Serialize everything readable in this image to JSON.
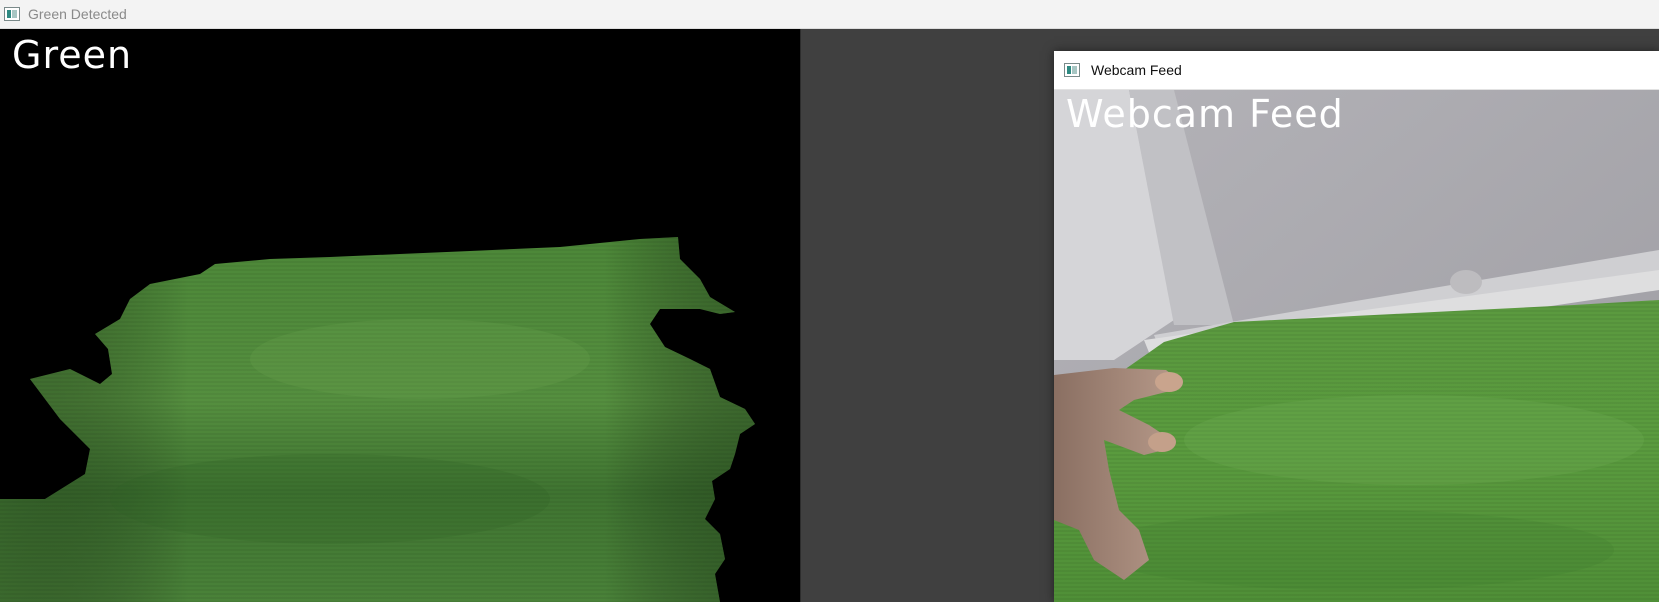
{
  "window_green": {
    "title": "Green Detected",
    "overlay_label": "Green",
    "icon": "opencv-window-icon"
  },
  "window_webcam": {
    "title": "Webcam Feed",
    "overlay_label": "Webcam Feed",
    "icon": "opencv-window-icon"
  },
  "colors": {
    "desktop_bg": "#404040",
    "mask_bg": "#000000",
    "cloth_green": "#4f8a3c",
    "wall_gray": "#a9a8ad",
    "label_text": "#ffffff"
  }
}
